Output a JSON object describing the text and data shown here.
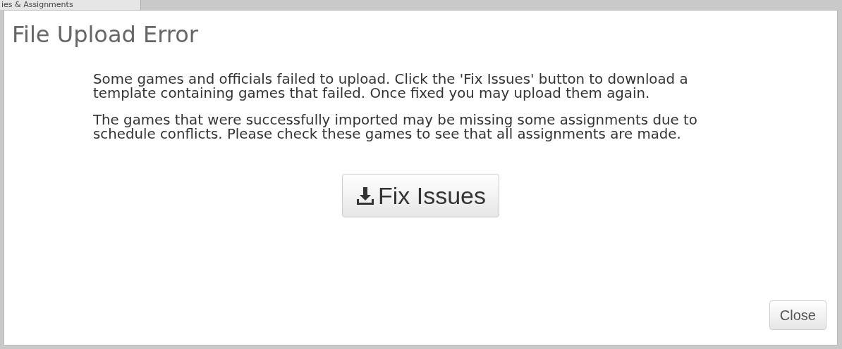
{
  "background_tab": {
    "label": "ies & Assignments"
  },
  "dialog": {
    "title": "File Upload Error",
    "paragraphs": [
      "Some games and officials failed to upload. Click the 'Fix Issues' button to download a template containing games that failed. Once fixed you may upload them again.",
      "The games that were successfully imported may be missing some assignments due to schedule conflicts. Please check these games to see that all assignments are made."
    ],
    "primary_button": {
      "label": "Fix Issues"
    },
    "close_button": {
      "label": "Close"
    }
  }
}
